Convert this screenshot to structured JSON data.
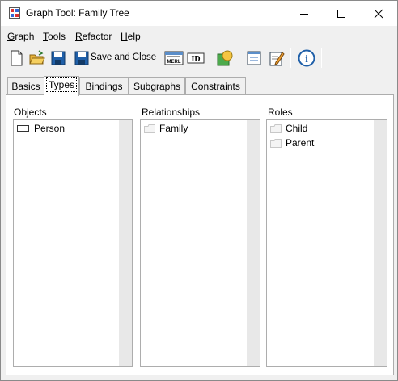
{
  "window": {
    "title": "Graph Tool: Family Tree"
  },
  "menu": [
    {
      "label": "Graph",
      "accel": "G",
      "rest": "raph"
    },
    {
      "label": "Tools",
      "accel": "T",
      "rest": "ools"
    },
    {
      "label": "Refactor",
      "accel": "R",
      "rest": "efactor"
    },
    {
      "label": "Help",
      "accel": "H",
      "rest": "elp"
    }
  ],
  "toolbar": {
    "save_close_label": "Save and Close",
    "merl_label": "MERL",
    "id_label": "ID",
    "info_label": "i"
  },
  "tabs": [
    {
      "label": "Basics",
      "active": false
    },
    {
      "label": "Types",
      "active": true
    },
    {
      "label": "Bindings",
      "active": false
    },
    {
      "label": "Subgraphs",
      "active": false
    },
    {
      "label": "Constraints",
      "active": false
    }
  ],
  "columns": {
    "objects": {
      "label": "Objects",
      "items": [
        "Person"
      ]
    },
    "relationships": {
      "label": "Relationships",
      "items": [
        "Family"
      ]
    },
    "roles": {
      "label": "Roles",
      "items": [
        "Child",
        "Parent"
      ]
    }
  }
}
